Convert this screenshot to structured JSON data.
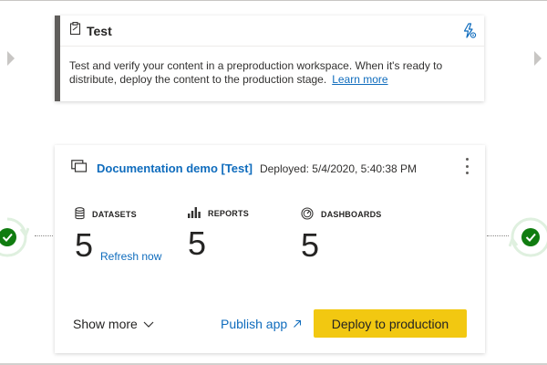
{
  "stage": {
    "title": "Test",
    "description": "Test and verify your content in a preproduction workspace. When it's ready to distribute, deploy the content to the production stage.",
    "learn_more": "Learn more",
    "icon": "clipboard-icon",
    "settings_icon": "lightning-settings-icon"
  },
  "workspace": {
    "name": "Documentation demo [Test]",
    "deployed": "Deployed: 5/4/2020, 5:40:38 PM",
    "icon": "workspace-icon"
  },
  "metrics": [
    {
      "label": "DATASETS",
      "value": "5",
      "icon": "database-icon",
      "action": "Refresh now"
    },
    {
      "label": "REPORTS",
      "value": "5",
      "icon": "bar-chart-icon"
    },
    {
      "label": "DASHBOARDS",
      "value": "5",
      "icon": "gauge-icon"
    }
  ],
  "actions": {
    "show_more": "Show more",
    "publish_app": "Publish app",
    "deploy": "Deploy to production"
  },
  "colors": {
    "accent_link": "#0f6cbd",
    "deploy_button": "#f2c811",
    "success": "#107c10",
    "stage_border": "#605e5c"
  }
}
